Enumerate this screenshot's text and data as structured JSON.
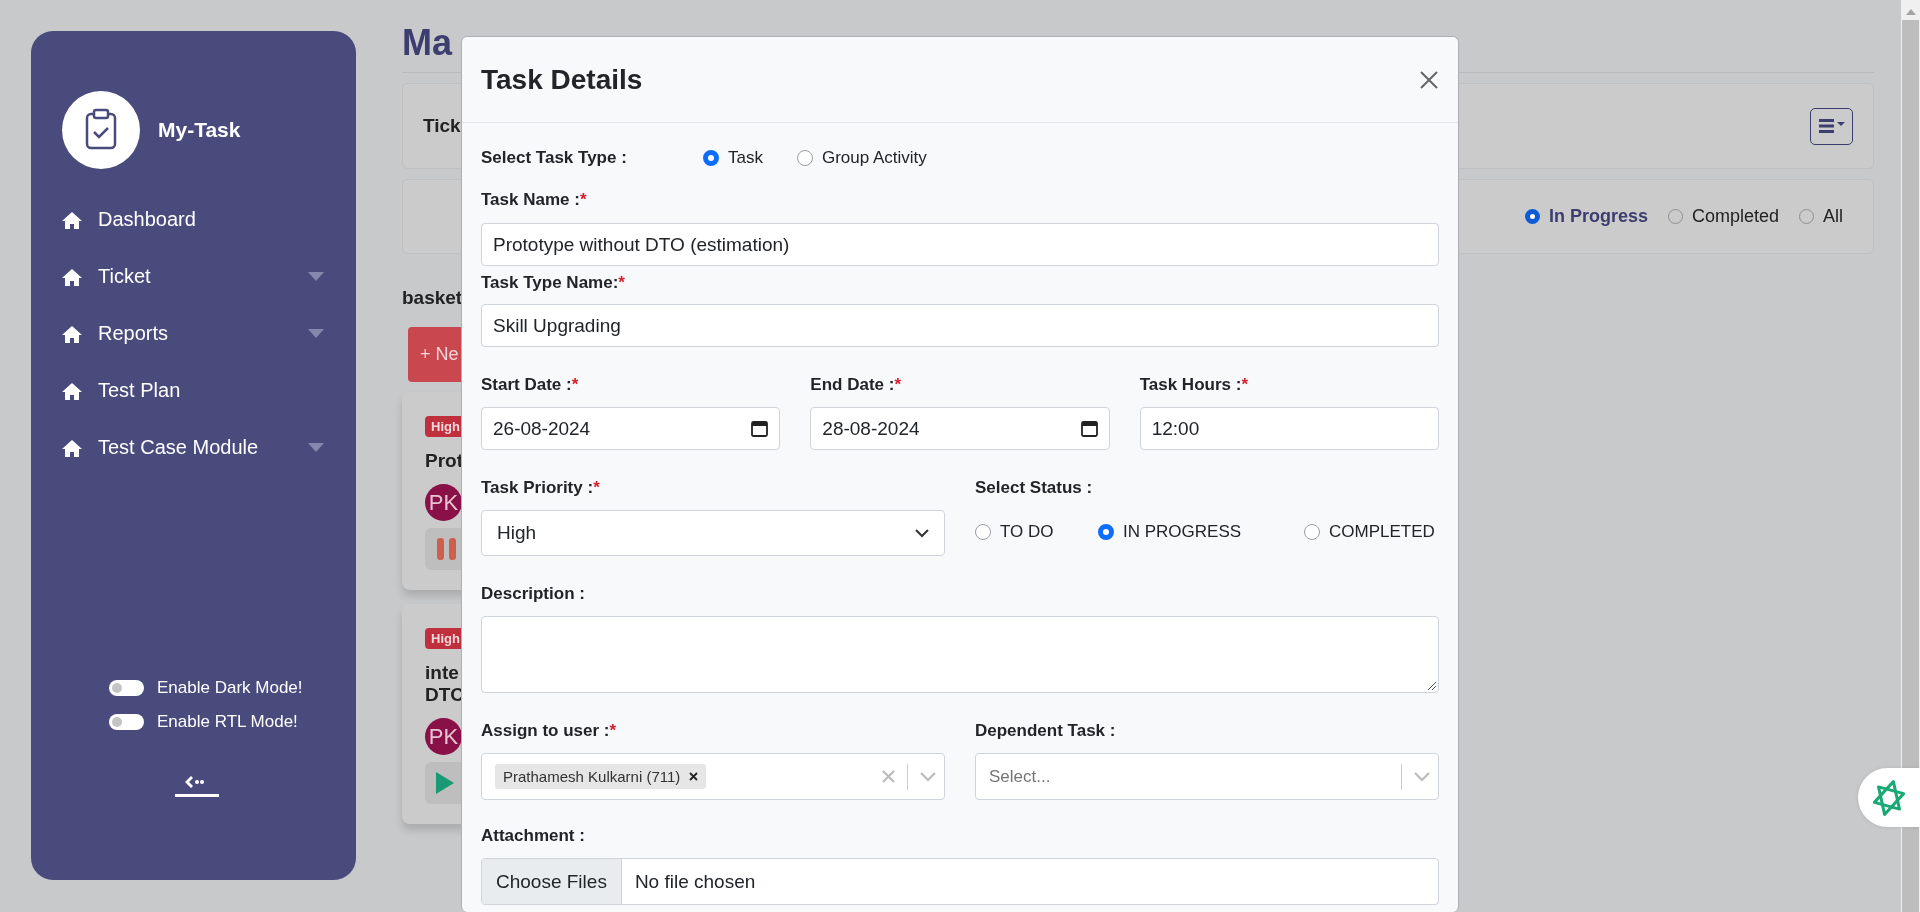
{
  "sidebar": {
    "brand": "My-Task",
    "items": [
      {
        "label": "Dashboard",
        "has_submenu": false
      },
      {
        "label": "Ticket",
        "has_submenu": true
      },
      {
        "label": "Reports",
        "has_submenu": true
      },
      {
        "label": "Test Plan",
        "has_submenu": false
      },
      {
        "label": "Test Case Module",
        "has_submenu": true
      }
    ],
    "toggles": [
      {
        "label": "Enable Dark Mode!",
        "on": false
      },
      {
        "label": "Enable RTL Mode!",
        "on": false
      }
    ]
  },
  "page": {
    "title": "Ma",
    "ticket_label": "Tick",
    "status_filter": [
      {
        "label": "In Progress",
        "selected": true
      },
      {
        "label": "Completed",
        "selected": false
      },
      {
        "label": "All",
        "selected": false
      }
    ],
    "section_title": "basket",
    "new_button": "+ Ne",
    "task_cards": [
      {
        "priority": "High",
        "title_lines": [
          "Prot"
        ],
        "avatar": "PK",
        "kind": "pause"
      },
      {
        "priority": "High",
        "title_lines": [
          "inte",
          "DTC"
        ],
        "avatar": "PK",
        "kind": "play"
      }
    ]
  },
  "modal": {
    "title": "Task Details",
    "task_type": {
      "label": "Select Task Type :",
      "options": [
        {
          "label": "Task",
          "selected": true
        },
        {
          "label": "Group Activity",
          "selected": false
        }
      ]
    },
    "task_name": {
      "label": "Task Name :",
      "required_mark": "*",
      "value": "Prototype without DTO (estimation)"
    },
    "task_type_name": {
      "label": "Task Type Name:",
      "required_mark": "*",
      "value": "Skill Upgrading"
    },
    "start_date": {
      "label": "Start Date :",
      "required_mark": "*",
      "value": "26-08-2024"
    },
    "end_date": {
      "label": "End Date :",
      "required_mark": "*",
      "value": "28-08-2024"
    },
    "task_hours": {
      "label": "Task Hours :",
      "required_mark": "*",
      "value": "12:00"
    },
    "priority": {
      "label": "Task Priority :",
      "required_mark": "*",
      "value": "High"
    },
    "status": {
      "label": "Select Status :",
      "options": [
        {
          "label": "TO DO",
          "selected": false
        },
        {
          "label": "IN PROGRESS",
          "selected": true
        },
        {
          "label": "COMPLETED",
          "selected": false
        }
      ]
    },
    "description": {
      "label": "Description :"
    },
    "assign_to": {
      "label": "Assign to user :",
      "required_mark": "*",
      "chips": [
        "Prathamesh Kulkarni (711)"
      ]
    },
    "dependent_task": {
      "label": "Dependent Task :",
      "placeholder": "Select..."
    },
    "attachment": {
      "label": "Attachment :",
      "button": "Choose Files",
      "status": "No file chosen"
    }
  }
}
